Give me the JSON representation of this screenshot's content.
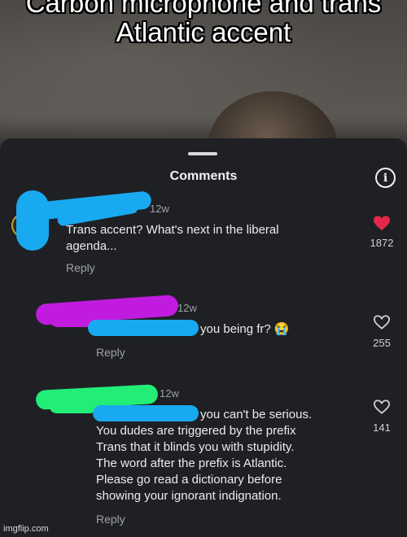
{
  "video": {
    "overlay_title": "Carbon microphone and trans Atlantic accent"
  },
  "sheet": {
    "title": "Comments",
    "info_icon": "info-icon",
    "grabber": "sheet-handle"
  },
  "comments": [
    {
      "timestamp": "12w",
      "text_line1": "Trans accent? What's next in the liberal",
      "text_line2": "agenda...",
      "reply_label": "Reply",
      "likes": "1872",
      "liked": true,
      "like_icon": "heart-filled-icon",
      "like_color": "#e3284b",
      "redaction_color": "#19a9f0"
    },
    {
      "timestamp": "12w",
      "text": "you being fr? 😭",
      "reply_label": "Reply",
      "likes": "255",
      "liked": false,
      "like_icon": "heart-outline-icon",
      "redaction_colors": [
        "#c21be0",
        "#19a9f0"
      ]
    },
    {
      "timestamp": "12w",
      "text_lines": [
        "you can't be serious.",
        "You dudes are triggered by the prefix",
        "Trans that it blinds you with stupidity.",
        "The word after the prefix is Atlantic.",
        "Please go read a dictionary before",
        "showing your ignorant indignation."
      ],
      "reply_label": "Reply",
      "likes": "141",
      "liked": false,
      "like_icon": "heart-outline-icon",
      "redaction_colors": [
        "#22ee77",
        "#19a9f0"
      ]
    }
  ],
  "watermark": "imgflip.com"
}
